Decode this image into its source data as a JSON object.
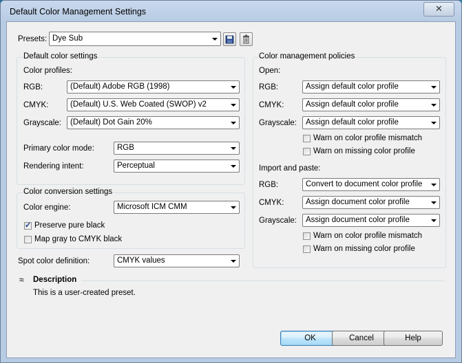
{
  "window": {
    "title": "Default Color Management Settings",
    "close_glyph": "✕"
  },
  "presets": {
    "label": "Presets:",
    "value": "Dye Sub",
    "save_icon": "save-icon",
    "delete_icon": "trash-icon"
  },
  "default_color": {
    "group_title": "Default color settings",
    "profiles_title": "Color profiles:",
    "rgb_label": "RGB:",
    "rgb_value": "(Default) Adobe RGB (1998)",
    "cmyk_label": "CMYK:",
    "cmyk_value": "(Default) U.S. Web Coated (SWOP) v2",
    "gray_label": "Grayscale:",
    "gray_value": "(Default) Dot Gain 20%",
    "primary_label": "Primary color mode:",
    "primary_value": "RGB",
    "intent_label": "Rendering intent:",
    "intent_value": "Perceptual"
  },
  "conversion": {
    "group_title": "Color conversion settings",
    "engine_label": "Color engine:",
    "engine_value": "Microsoft ICM CMM",
    "preserve_label": "Preserve pure black",
    "preserve_checked": true,
    "mapgray_label": "Map gray to CMYK black",
    "mapgray_checked": false
  },
  "spot": {
    "label": "Spot color definition:",
    "value": "CMYK values"
  },
  "policies": {
    "group_title": "Color management policies",
    "open_title": "Open:",
    "open_rgb_label": "RGB:",
    "open_rgb_value": "Assign default color profile",
    "open_cmyk_label": "CMYK:",
    "open_cmyk_value": "Assign default color profile",
    "open_gray_label": "Grayscale:",
    "open_gray_value": "Assign default color profile",
    "open_warn_mismatch": "Warn on color profile mismatch",
    "open_warn_missing": "Warn on missing color profile",
    "import_title": "Import and paste:",
    "imp_rgb_label": "RGB:",
    "imp_rgb_value": "Convert to document color profile",
    "imp_cmyk_label": "CMYK:",
    "imp_cmyk_value": "Assign document color profile",
    "imp_gray_label": "Grayscale:",
    "imp_gray_value": "Assign document color profile",
    "imp_warn_mismatch": "Warn on color profile mismatch",
    "imp_warn_missing": "Warn on missing color profile"
  },
  "description": {
    "title": "Description",
    "text": "This is a user-created preset.",
    "toggle_glyph": "≈"
  },
  "buttons": {
    "ok": "OK",
    "cancel": "Cancel",
    "help": "Help"
  }
}
